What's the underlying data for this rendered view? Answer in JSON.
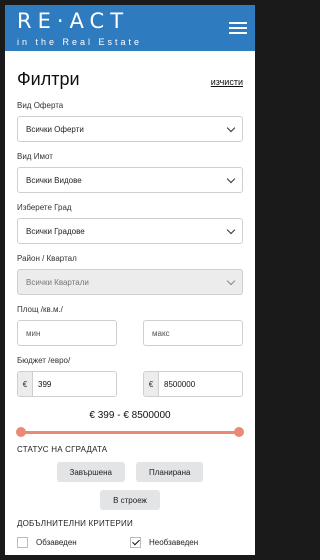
{
  "header": {
    "logo": "RE·ACT",
    "tagline": "in the Real Estate",
    "menu_icon": "hamburger-menu-icon"
  },
  "title": "Филтри",
  "clear_label": "изчисти",
  "offer_type": {
    "label": "Вид Оферта",
    "value": "Всички Оферти"
  },
  "property_type": {
    "label": "Вид Имот",
    "value": "Всички Видове"
  },
  "city": {
    "label": "Изберете Град",
    "value": "Всички Градове"
  },
  "district": {
    "label": "Район / Квартал",
    "value": "Всички Квартали",
    "disabled": true
  },
  "area": {
    "label": "Площ /кв.м./",
    "min_placeholder": "мин",
    "max_placeholder": "макс"
  },
  "budget": {
    "label": "Бюджет /евро/",
    "currency": "€",
    "min": "399",
    "max": "8500000"
  },
  "range_text": {
    "min": "€ 399",
    "separator": "-",
    "max": "€ 8500000"
  },
  "slider_color": "#e98a72",
  "building_status": {
    "title": "СТАТУС НА СГРАДАТА",
    "options": [
      "Завършена",
      "Планирана",
      "В строеж"
    ]
  },
  "extras": {
    "title": "ДОБЪЛНИТЕЛНИ КРИТЕРИИ",
    "options": [
      {
        "label": "Обзаведен",
        "checked": false
      },
      {
        "label": "Необзаведен",
        "checked": true
      }
    ]
  },
  "colors": {
    "header": "#2f7bbf",
    "chip": "#e3e4e6"
  }
}
